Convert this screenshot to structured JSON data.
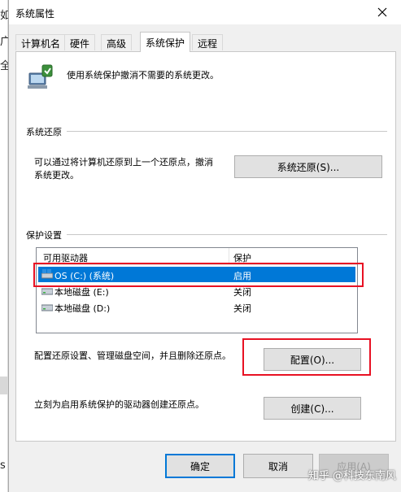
{
  "background": {
    "chars": [
      "如",
      "广",
      "全",
      "s"
    ]
  },
  "window": {
    "title": "系统属性",
    "close_icon": "close-icon"
  },
  "tabs": [
    {
      "label": "计算机名",
      "active": false
    },
    {
      "label": "硬件",
      "active": false
    },
    {
      "label": "高级",
      "active": false
    },
    {
      "label": "系统保护",
      "active": true
    },
    {
      "label": "远程",
      "active": false
    }
  ],
  "intro": {
    "text": "使用系统保护撤消不需要的系统更改。",
    "icon": "computer-shield-icon"
  },
  "restore": {
    "group_title": "系统还原",
    "description_line1": "可以通过将计算机还原到上一个还原点，撤消",
    "description_line2": "系统更改。",
    "button_label": "系统还原(S)..."
  },
  "protection": {
    "group_title": "保护设置",
    "columns": [
      "可用驱动器",
      "保护"
    ],
    "drives": [
      {
        "name": "OS (C:) (系统)",
        "protection": "启用",
        "selected": true,
        "icon": "system-drive-icon"
      },
      {
        "name": "本地磁盘 (E:)",
        "protection": "关闭",
        "selected": false,
        "icon": "drive-icon"
      },
      {
        "name": "本地磁盘 (D:)",
        "protection": "关闭",
        "selected": false,
        "icon": "drive-icon"
      }
    ],
    "configure_text": "配置还原设置、管理磁盘空间，并且删除还原点。",
    "configure_button": "配置(O)...",
    "create_text": "立刻为启用系统保护的驱动器创建还原点。",
    "create_button": "创建(C)..."
  },
  "footer": {
    "ok": "确定",
    "cancel": "取消",
    "apply": "应用(A)"
  },
  "watermark": "知乎 @科技东南风",
  "colors": {
    "selection": "#0078d7",
    "highlight_box": "#e81123",
    "dialog_bg": "#f0f0f0"
  }
}
